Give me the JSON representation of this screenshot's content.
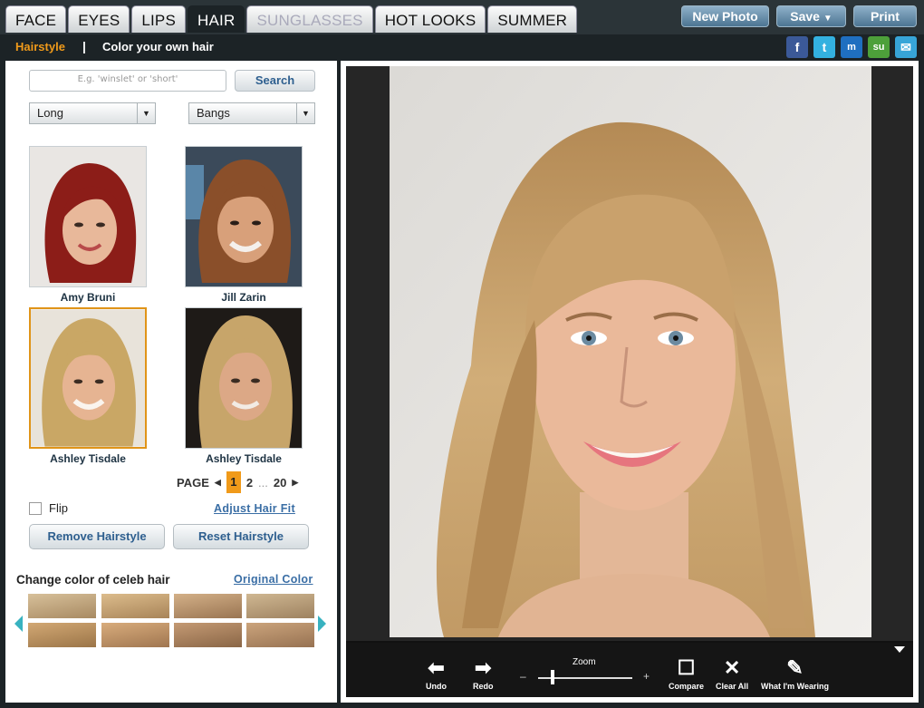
{
  "tabs": [
    "FACE",
    "EYES",
    "LIPS",
    "HAIR",
    "SUNGLASSES",
    "HOT LOOKS",
    "SUMMER"
  ],
  "top_buttons": {
    "new_photo": "New Photo",
    "save": "Save",
    "print": "Print"
  },
  "subnav": {
    "hairstyle": "Hairstyle",
    "separator": "|",
    "color": "Color your own hair"
  },
  "social": [
    "f",
    "t",
    "m",
    "su",
    "✉"
  ],
  "search": {
    "placeholder": "E.g. 'winslet' or 'short'",
    "button": "Search"
  },
  "filters": {
    "length": "Long",
    "style": "Bangs"
  },
  "celebs": [
    {
      "name": "Amy Bruni",
      "hair": "#8c1d18",
      "bg": "#e9e6e3"
    },
    {
      "name": "Jill Zarin",
      "hair": "#8a4f2a",
      "bg": "#3b4a5a"
    },
    {
      "name": "Ashley Tisdale",
      "hair": "#c9a765",
      "bg": "#e8e3da"
    },
    {
      "name": "Ashley Tisdale",
      "hair": "#c7a56a",
      "bg": "#1e1a17"
    }
  ],
  "pager": {
    "label": "PAGE",
    "current": "1",
    "next": "2",
    "dots": "...",
    "last": "20"
  },
  "flip": "Flip",
  "adjust": "Adjust Hair Fit",
  "buttons": {
    "remove": "Remove Hairstyle",
    "reset": "Reset Hairstyle"
  },
  "color": {
    "title": "Change color of celeb hair",
    "original": "Original Color"
  },
  "swatches": [
    "#bfa47e",
    "#c7a173",
    "#b8936a",
    "#b39a77",
    "#b58e60",
    "#bc9467",
    "#a6825d",
    "#b08c66"
  ],
  "toolbar": {
    "undo": "Undo",
    "redo": "Redo",
    "zoom": "Zoom",
    "minus": "–",
    "plus": "+",
    "compare": "Compare",
    "clear": "Clear All",
    "wearing": "What I'm Wearing"
  }
}
